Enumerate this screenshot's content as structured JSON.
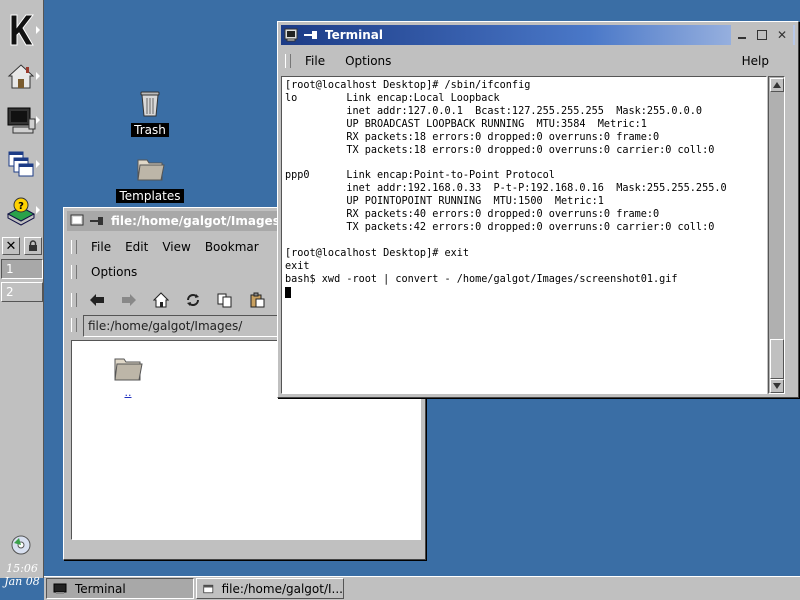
{
  "panel": {
    "desktops": [
      "1",
      "2"
    ],
    "clock_time": "15:06",
    "clock_date": "Jan 08"
  },
  "desktop_icons": {
    "trash": "Trash",
    "templates": "Templates"
  },
  "terminal": {
    "title": "Terminal",
    "menu": {
      "file": "File",
      "options": "Options",
      "help": "Help"
    },
    "output": "[root@localhost Desktop]# /sbin/ifconfig\nlo        Link encap:Local Loopback\n          inet addr:127.0.0.1  Bcast:127.255.255.255  Mask:255.0.0.0\n          UP BROADCAST LOOPBACK RUNNING  MTU:3584  Metric:1\n          RX packets:18 errors:0 dropped:0 overruns:0 frame:0\n          TX packets:18 errors:0 dropped:0 overruns:0 carrier:0 coll:0\n\nppp0      Link encap:Point-to-Point Protocol\n          inet addr:192.168.0.33  P-t-P:192.168.0.16  Mask:255.255.255.0\n          UP POINTOPOINT RUNNING  MTU:1500  Metric:1\n          RX packets:40 errors:0 dropped:0 overruns:0 frame:0\n          TX packets:42 errors:0 dropped:0 overruns:0 carrier:0 coll:0\n\n[root@localhost Desktop]# exit\nexit\nbash$ xwd -root | convert - /home/galgot/Images/screenshot01.gif\n"
  },
  "konqueror": {
    "title": "file:/home/galgot/Images/",
    "menu": {
      "file": "File",
      "edit": "Edit",
      "view": "View",
      "bookmarks": "Bookmar",
      "options": "Options"
    },
    "location": "file:/home/galgot/Images/",
    "folder_label": ".."
  },
  "taskbar": {
    "items": [
      "Terminal",
      "file:/home/galgot/I..."
    ]
  },
  "colors": {
    "desktop": "#3a6ea5",
    "chrome": "#c0c0c0",
    "active_title": "#1c3b86"
  }
}
